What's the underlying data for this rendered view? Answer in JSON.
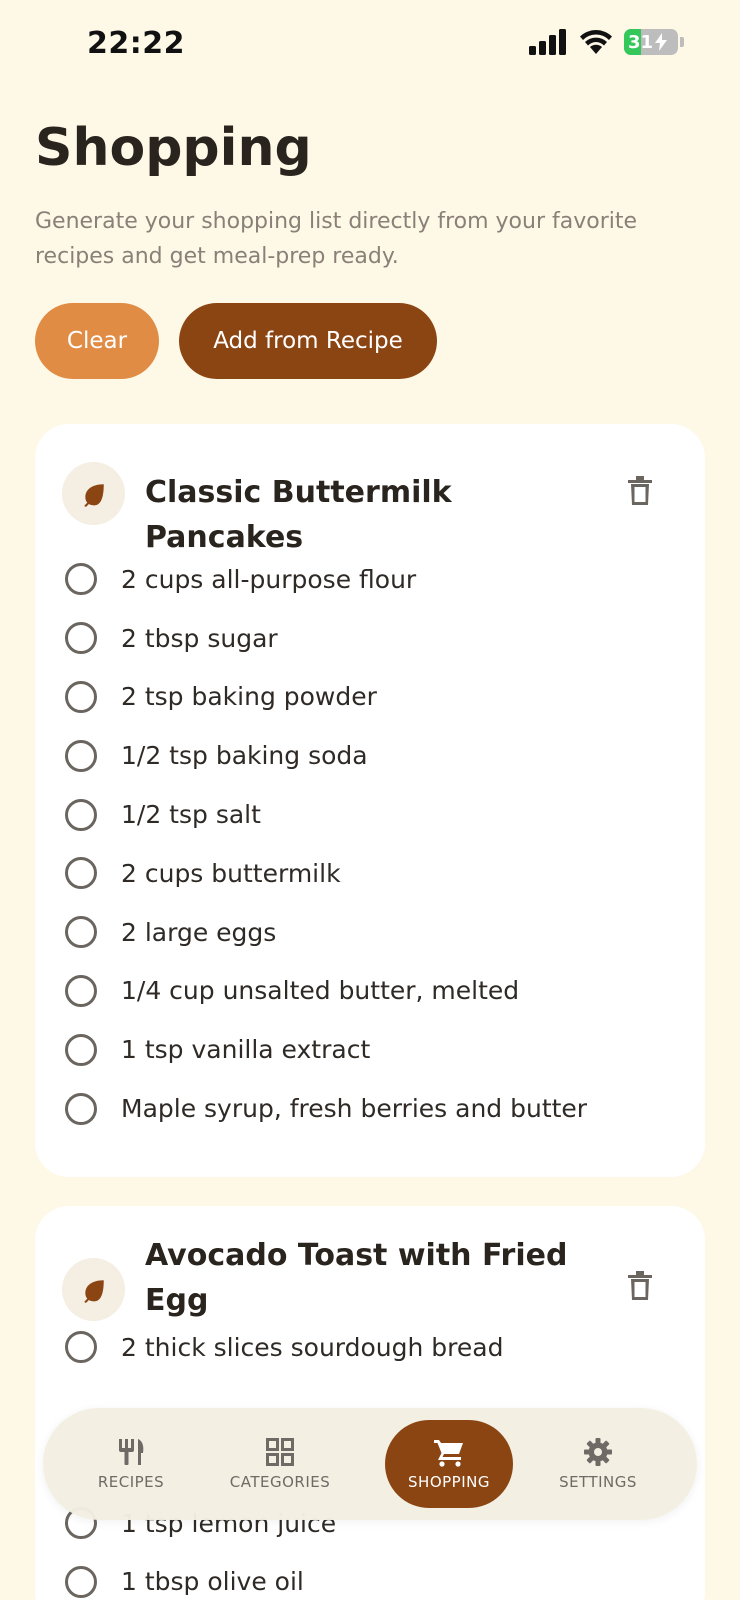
{
  "status": {
    "time": "22:22",
    "battery": "31",
    "battery_level": 0.31
  },
  "header": {
    "title": "Shopping",
    "subtitle": "Generate your shopping list directly from your favorite recipes and get meal-prep ready."
  },
  "actions": {
    "clear_label": "Clear",
    "add_label": "Add from Recipe"
  },
  "recipes": [
    {
      "title": "Classic Buttermilk Pancakes",
      "items": [
        "2 cups all-purpose flour",
        "2 tbsp sugar",
        "2 tsp baking powder",
        "1/2 tsp baking soda",
        "1/2 tsp salt",
        "2 cups buttermilk",
        "2 large eggs",
        "1/4 cup unsalted butter, melted",
        "1 tsp vanilla extract",
        "Maple syrup, fresh berries and butter"
      ]
    },
    {
      "title": "Avocado Toast with Fried Egg",
      "items": [
        "2 thick slices sourdough bread",
        "1 tsp lemon juice",
        "1 tbsp olive oil"
      ]
    }
  ],
  "nav": [
    {
      "label": "RECIPES",
      "icon": "fork-knife-icon"
    },
    {
      "label": "CATEGORIES",
      "icon": "grid-icon"
    },
    {
      "label": "SHOPPING",
      "icon": "cart-icon",
      "active": true
    },
    {
      "label": "SETTINGS",
      "icon": "gear-icon"
    }
  ],
  "colors": {
    "background": "#FEF8E7",
    "accent": "#8B4513",
    "clear": "#E08C45"
  }
}
